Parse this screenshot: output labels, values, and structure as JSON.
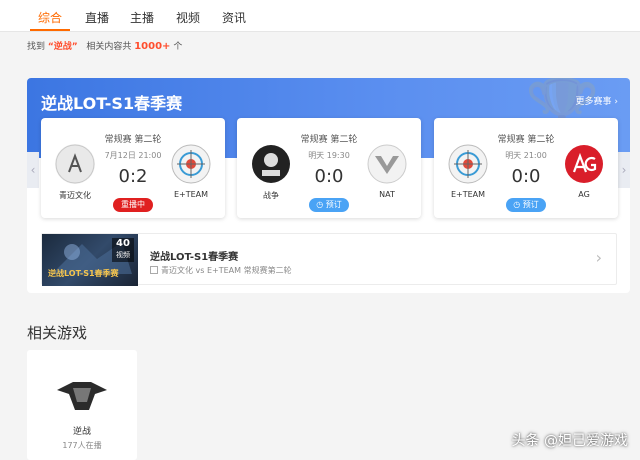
{
  "tabs": [
    {
      "label": "综合",
      "active": true
    },
    {
      "label": "直播"
    },
    {
      "label": "主播"
    },
    {
      "label": "视频"
    },
    {
      "label": "资讯"
    }
  ],
  "result": {
    "prefix": "找到",
    "keyword": "“逆战”",
    "middle": "相关内容共",
    "count": "1000+",
    "suffix": "个"
  },
  "event": {
    "title": "逆战LOT-S1春季赛",
    "more_label": "更多赛事 ›",
    "matches": [
      {
        "stage": "常规赛 第二轮",
        "time": "7月12日 21:00",
        "score": "0:2",
        "team_a": "青迈文化",
        "team_b": "E+TEAM",
        "status": "重播中",
        "status_type": "live"
      },
      {
        "stage": "常规赛 第二轮",
        "time": "明天 19:30",
        "score": "0:0",
        "team_a": "战争",
        "team_b": "NAT",
        "status": "预订",
        "status_type": "book"
      },
      {
        "stage": "常规赛 第二轮",
        "time": "明天 21:00",
        "score": "0:0",
        "team_a": "E+TEAM",
        "team_b": "AG",
        "status": "预订",
        "status_type": "book"
      }
    ],
    "video": {
      "thumb_count": "40",
      "thumb_count_label": "视频",
      "thumb_title": "逆战LOT-S1春季赛",
      "title": "逆战LOT-S1春季赛",
      "subtitle": "青迈文化 vs E+TEAM 常规赛第二轮"
    }
  },
  "related": {
    "title": "相关游戏",
    "game": {
      "name": "逆战",
      "viewers": "177人在播"
    }
  },
  "watermark": "头条 @妲己爱游戏",
  "colors": {
    "accent": "#ff6a00",
    "banner": "#3c76e2",
    "live": "#e02020",
    "book": "#4aa3f5"
  }
}
